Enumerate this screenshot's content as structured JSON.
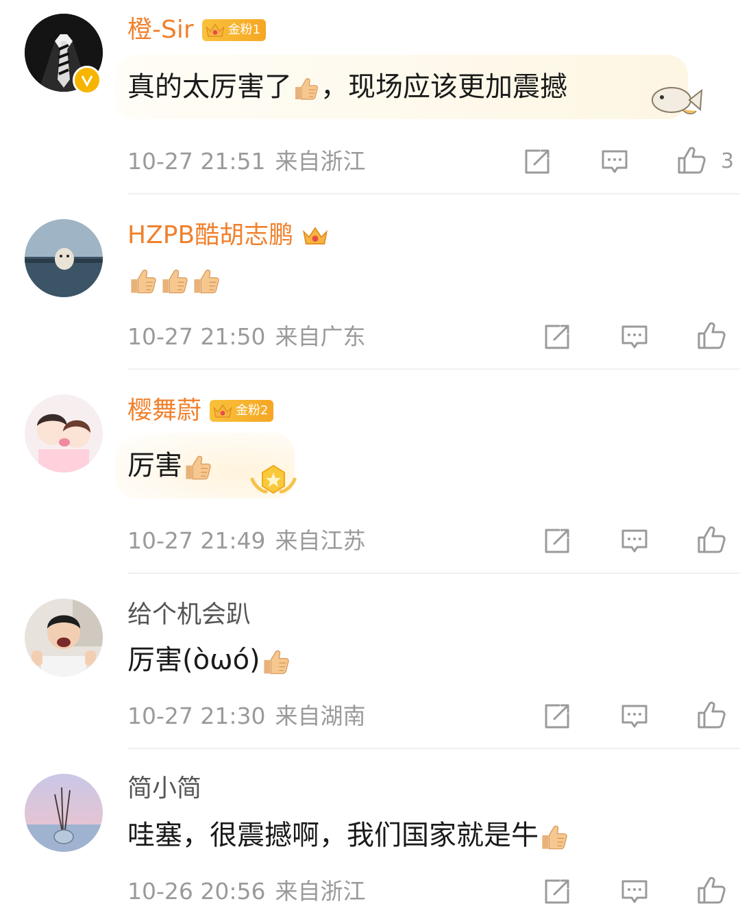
{
  "comments": [
    {
      "name": "橙-Sir",
      "badge": "金粉1",
      "text_before": "真的太厉害了",
      "text_after": "，现场应该更加震撼",
      "time": "10-27 21:51",
      "location": "来自浙江",
      "like_count": "3"
    },
    {
      "name": "HZPB酷胡志鹏",
      "time": "10-27 21:50",
      "location": "来自广东"
    },
    {
      "name": "樱舞蔚",
      "badge": "金粉2",
      "text": "厉害",
      "time": "10-27 21:49",
      "location": "来自江苏"
    },
    {
      "name": "给个机会趴",
      "text": "厉害(òωó)",
      "time": "10-27 21:30",
      "location": "来自湖南"
    },
    {
      "name": "简小简",
      "text": "哇塞，很震撼啊，我们国家就是牛",
      "time": "10-26 20:56",
      "location": "来自浙江"
    }
  ],
  "icons": {
    "share": "share-icon",
    "reply": "comment-icon",
    "like": "thumbs-up-icon",
    "emoji": "thumbs-up-emoji"
  },
  "colors": {
    "gold_name": "#f0812d",
    "plain_name": "#555555",
    "meta": "#9a9a9a",
    "badge": "#f6a623",
    "verified": "#f7b500"
  }
}
